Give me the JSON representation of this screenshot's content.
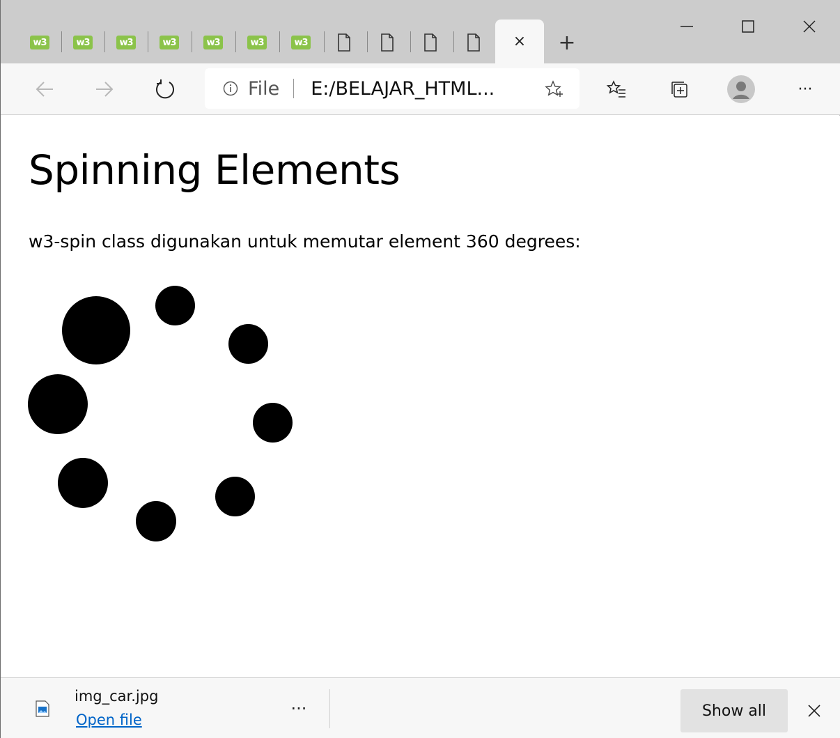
{
  "browser": {
    "tabs": [
      {
        "icon": "w3-icon",
        "label": "w3"
      },
      {
        "icon": "w3-icon",
        "label": "w3"
      },
      {
        "icon": "w3-icon",
        "label": "w3"
      },
      {
        "icon": "w3-icon",
        "label": "w3"
      },
      {
        "icon": "w3-icon",
        "label": "w3"
      },
      {
        "icon": "w3-icon",
        "label": "w3"
      },
      {
        "icon": "w3-icon",
        "label": "w3"
      },
      {
        "icon": "document-icon"
      },
      {
        "icon": "document-icon"
      },
      {
        "icon": "document-icon"
      },
      {
        "icon": "document-icon"
      }
    ],
    "active_tab_close": "×",
    "new_tab_label": "+",
    "address_bar": {
      "scheme_label": "File",
      "url": "E:/BELAJAR_HTML..."
    },
    "toolbar_icons": [
      "back-icon",
      "forward-icon",
      "refresh-icon",
      "info-icon",
      "favorite-star-icon",
      "favorites-list-icon",
      "collections-icon",
      "profile-avatar-icon",
      "more-icon"
    ],
    "more_label": "···",
    "accent_w3": "#8bc34a"
  },
  "page": {
    "title": "Spinning Elements",
    "description": "w3-spin class digunakan untuk memutar element 360 degrees:"
  },
  "download_bar": {
    "file_name": "img_car.jpg",
    "open_link": "Open file",
    "more_label": "···",
    "show_all_label": "Show all",
    "file_icon": "image-file-icon"
  }
}
